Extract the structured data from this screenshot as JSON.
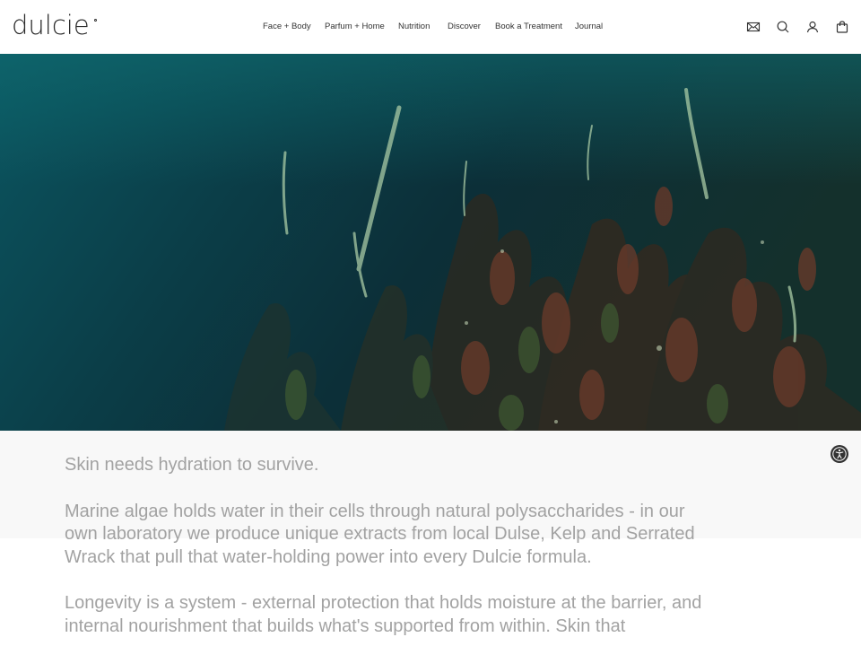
{
  "brand": {
    "logo_text": "dulcie"
  },
  "nav": {
    "items": [
      {
        "label": "Face + Body"
      },
      {
        "label": "Parfum + Home"
      },
      {
        "label": "Nutrition"
      },
      {
        "label": "Discover"
      },
      {
        "label": "Book a Treatment"
      },
      {
        "label": "Journal"
      }
    ]
  },
  "header_icons": [
    "mail-icon",
    "search-icon",
    "account-icon",
    "bag-icon"
  ],
  "hero": {
    "description_icon": "aerial-seaweed-image"
  },
  "content": {
    "paragraphs": [
      "Skin needs hydration to survive.",
      "Marine algae holds water in their cells through natural polysaccharides - in our own laboratory we produce unique extracts from local Dulse, Kelp and Serrated Wrack that pull that water-holding power into every Dulcie formula.",
      "Longevity is a system - external protection that holds moisture at the barrier, and internal nourishment that builds what's supported from within. Skin that"
    ]
  },
  "accessibility": {
    "icon": "accessibility-icon"
  },
  "colors": {
    "text_body": "#a2a2a2",
    "nav_text": "#333333",
    "band_bg": "#f8f8f8"
  }
}
